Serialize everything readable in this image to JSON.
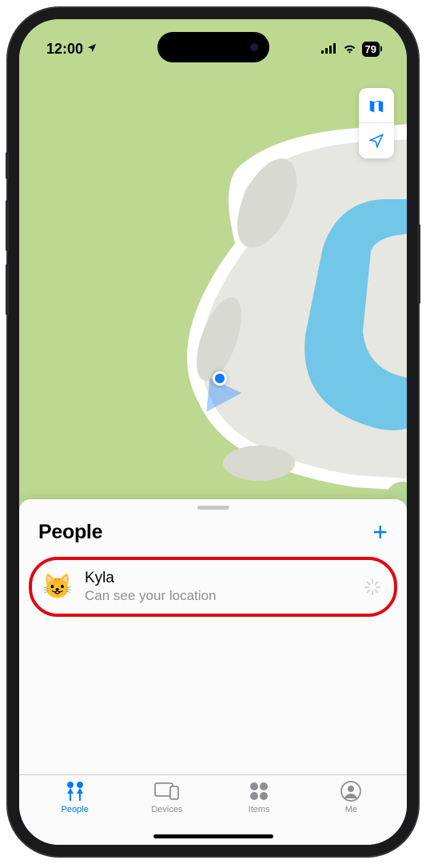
{
  "status": {
    "time": "12:00",
    "location_icon": "➤",
    "battery": "79"
  },
  "map": {
    "controls": {
      "map_mode": "map-mode-icon",
      "locate": "locate-icon"
    }
  },
  "sheet": {
    "title": "People",
    "add": "+",
    "people": [
      {
        "avatar": "😺",
        "name": "Kyla",
        "status": "Can see your location"
      }
    ]
  },
  "tabs": [
    {
      "id": "people",
      "label": "People",
      "active": true
    },
    {
      "id": "devices",
      "label": "Devices",
      "active": false
    },
    {
      "id": "items",
      "label": "Items",
      "active": false
    },
    {
      "id": "me",
      "label": "Me",
      "active": false
    }
  ]
}
